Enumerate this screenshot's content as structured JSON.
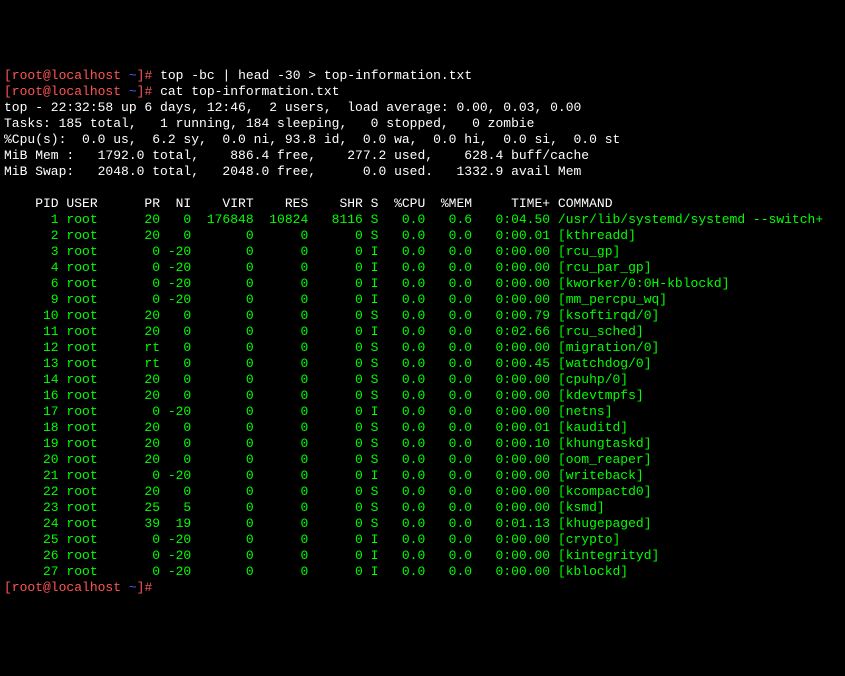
{
  "prompt": {
    "user_host": "[root@localhost",
    "path": "~",
    "sep": "]#"
  },
  "cmd1": "top -bc | head -30 > top-information.txt",
  "cmd2": "cat top-information.txt",
  "summary": {
    "line1": "top - 22:32:58 up 6 days, 12:46,  2 users,  load average: 0.00, 0.03, 0.00",
    "line2": "Tasks: 185 total,   1 running, 184 sleeping,   0 stopped,   0 zombie",
    "line3": "%Cpu(s):  0.0 us,  6.2 sy,  0.0 ni, 93.8 id,  0.0 wa,  0.0 hi,  0.0 si,  0.0 st",
    "line4": "MiB Mem :   1792.0 total,    886.4 free,    277.2 used,    628.4 buff/cache",
    "line5": "MiB Swap:   2048.0 total,   2048.0 free,      0.0 used.   1332.9 avail Mem"
  },
  "columns": "    PID USER      PR  NI    VIRT    RES    SHR S  %CPU  %MEM     TIME+ COMMAND",
  "rows": [
    "      1 root      20   0  176848  10824   8116 S   0.0   0.6   0:04.50 /usr/lib/systemd/systemd --switch+",
    "      2 root      20   0       0      0      0 S   0.0   0.0   0:00.01 [kthreadd]",
    "      3 root       0 -20       0      0      0 I   0.0   0.0   0:00.00 [rcu_gp]",
    "      4 root       0 -20       0      0      0 I   0.0   0.0   0:00.00 [rcu_par_gp]",
    "      6 root       0 -20       0      0      0 I   0.0   0.0   0:00.00 [kworker/0:0H-kblockd]",
    "      9 root       0 -20       0      0      0 I   0.0   0.0   0:00.00 [mm_percpu_wq]",
    "     10 root      20   0       0      0      0 S   0.0   0.0   0:00.79 [ksoftirqd/0]",
    "     11 root      20   0       0      0      0 I   0.0   0.0   0:02.66 [rcu_sched]",
    "     12 root      rt   0       0      0      0 S   0.0   0.0   0:00.00 [migration/0]",
    "     13 root      rt   0       0      0      0 S   0.0   0.0   0:00.45 [watchdog/0]",
    "     14 root      20   0       0      0      0 S   0.0   0.0   0:00.00 [cpuhp/0]",
    "     16 root      20   0       0      0      0 S   0.0   0.0   0:00.00 [kdevtmpfs]",
    "     17 root       0 -20       0      0      0 I   0.0   0.0   0:00.00 [netns]",
    "     18 root      20   0       0      0      0 S   0.0   0.0   0:00.01 [kauditd]",
    "     19 root      20   0       0      0      0 S   0.0   0.0   0:00.10 [khungtaskd]",
    "     20 root      20   0       0      0      0 S   0.0   0.0   0:00.00 [oom_reaper]",
    "     21 root       0 -20       0      0      0 I   0.0   0.0   0:00.00 [writeback]",
    "     22 root      20   0       0      0      0 S   0.0   0.0   0:00.00 [kcompactd0]",
    "     23 root      25   5       0      0      0 S   0.0   0.0   0:00.00 [ksmd]",
    "     24 root      39  19       0      0      0 S   0.0   0.0   0:01.13 [khugepaged]",
    "     25 root       0 -20       0      0      0 I   0.0   0.0   0:00.00 [crypto]",
    "     26 root       0 -20       0      0      0 I   0.0   0.0   0:00.00 [kintegrityd]",
    "     27 root       0 -20       0      0      0 I   0.0   0.0   0:00.00 [kblockd]"
  ]
}
